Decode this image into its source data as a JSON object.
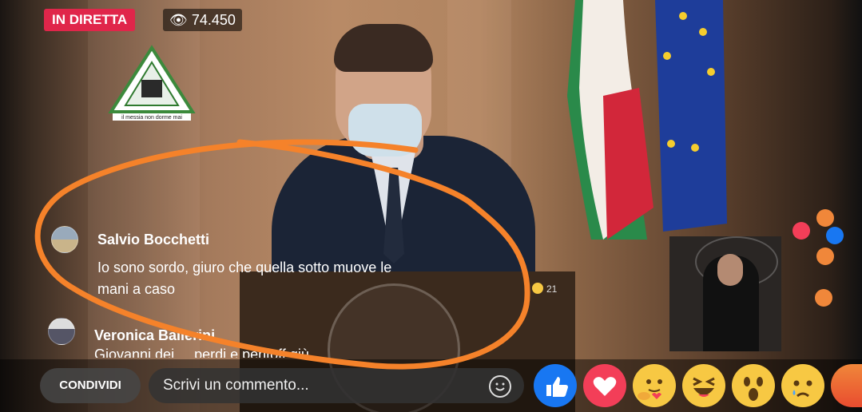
{
  "stream": {
    "live_label": "IN DIRETTA",
    "viewer_count": "74.450"
  },
  "logo": {
    "text": "il messia non dorme mai"
  },
  "comments": [
    {
      "author": "Salvio Bocchetti",
      "text_line1": "Io sono sordo, giuro che quella sotto muove le",
      "text_line2": "mani a caso",
      "reaction_count": "21"
    },
    {
      "author": "Veronica Ballerini",
      "text_partial": "Giovanni dei ... perdi e pentoff giù ..."
    }
  ],
  "bottom_bar": {
    "share_label": "CONDIVIDI",
    "comment_placeholder": "Scrivi un commento..."
  },
  "reactions": [
    "like",
    "love",
    "care",
    "haha",
    "wow",
    "sad",
    "angry"
  ],
  "colors": {
    "live_red": "#e0264a",
    "like_blue": "#1877f2",
    "love_red": "#f33e58",
    "emoji_yellow": "#f7c843",
    "annotation_orange": "#f5822a"
  }
}
